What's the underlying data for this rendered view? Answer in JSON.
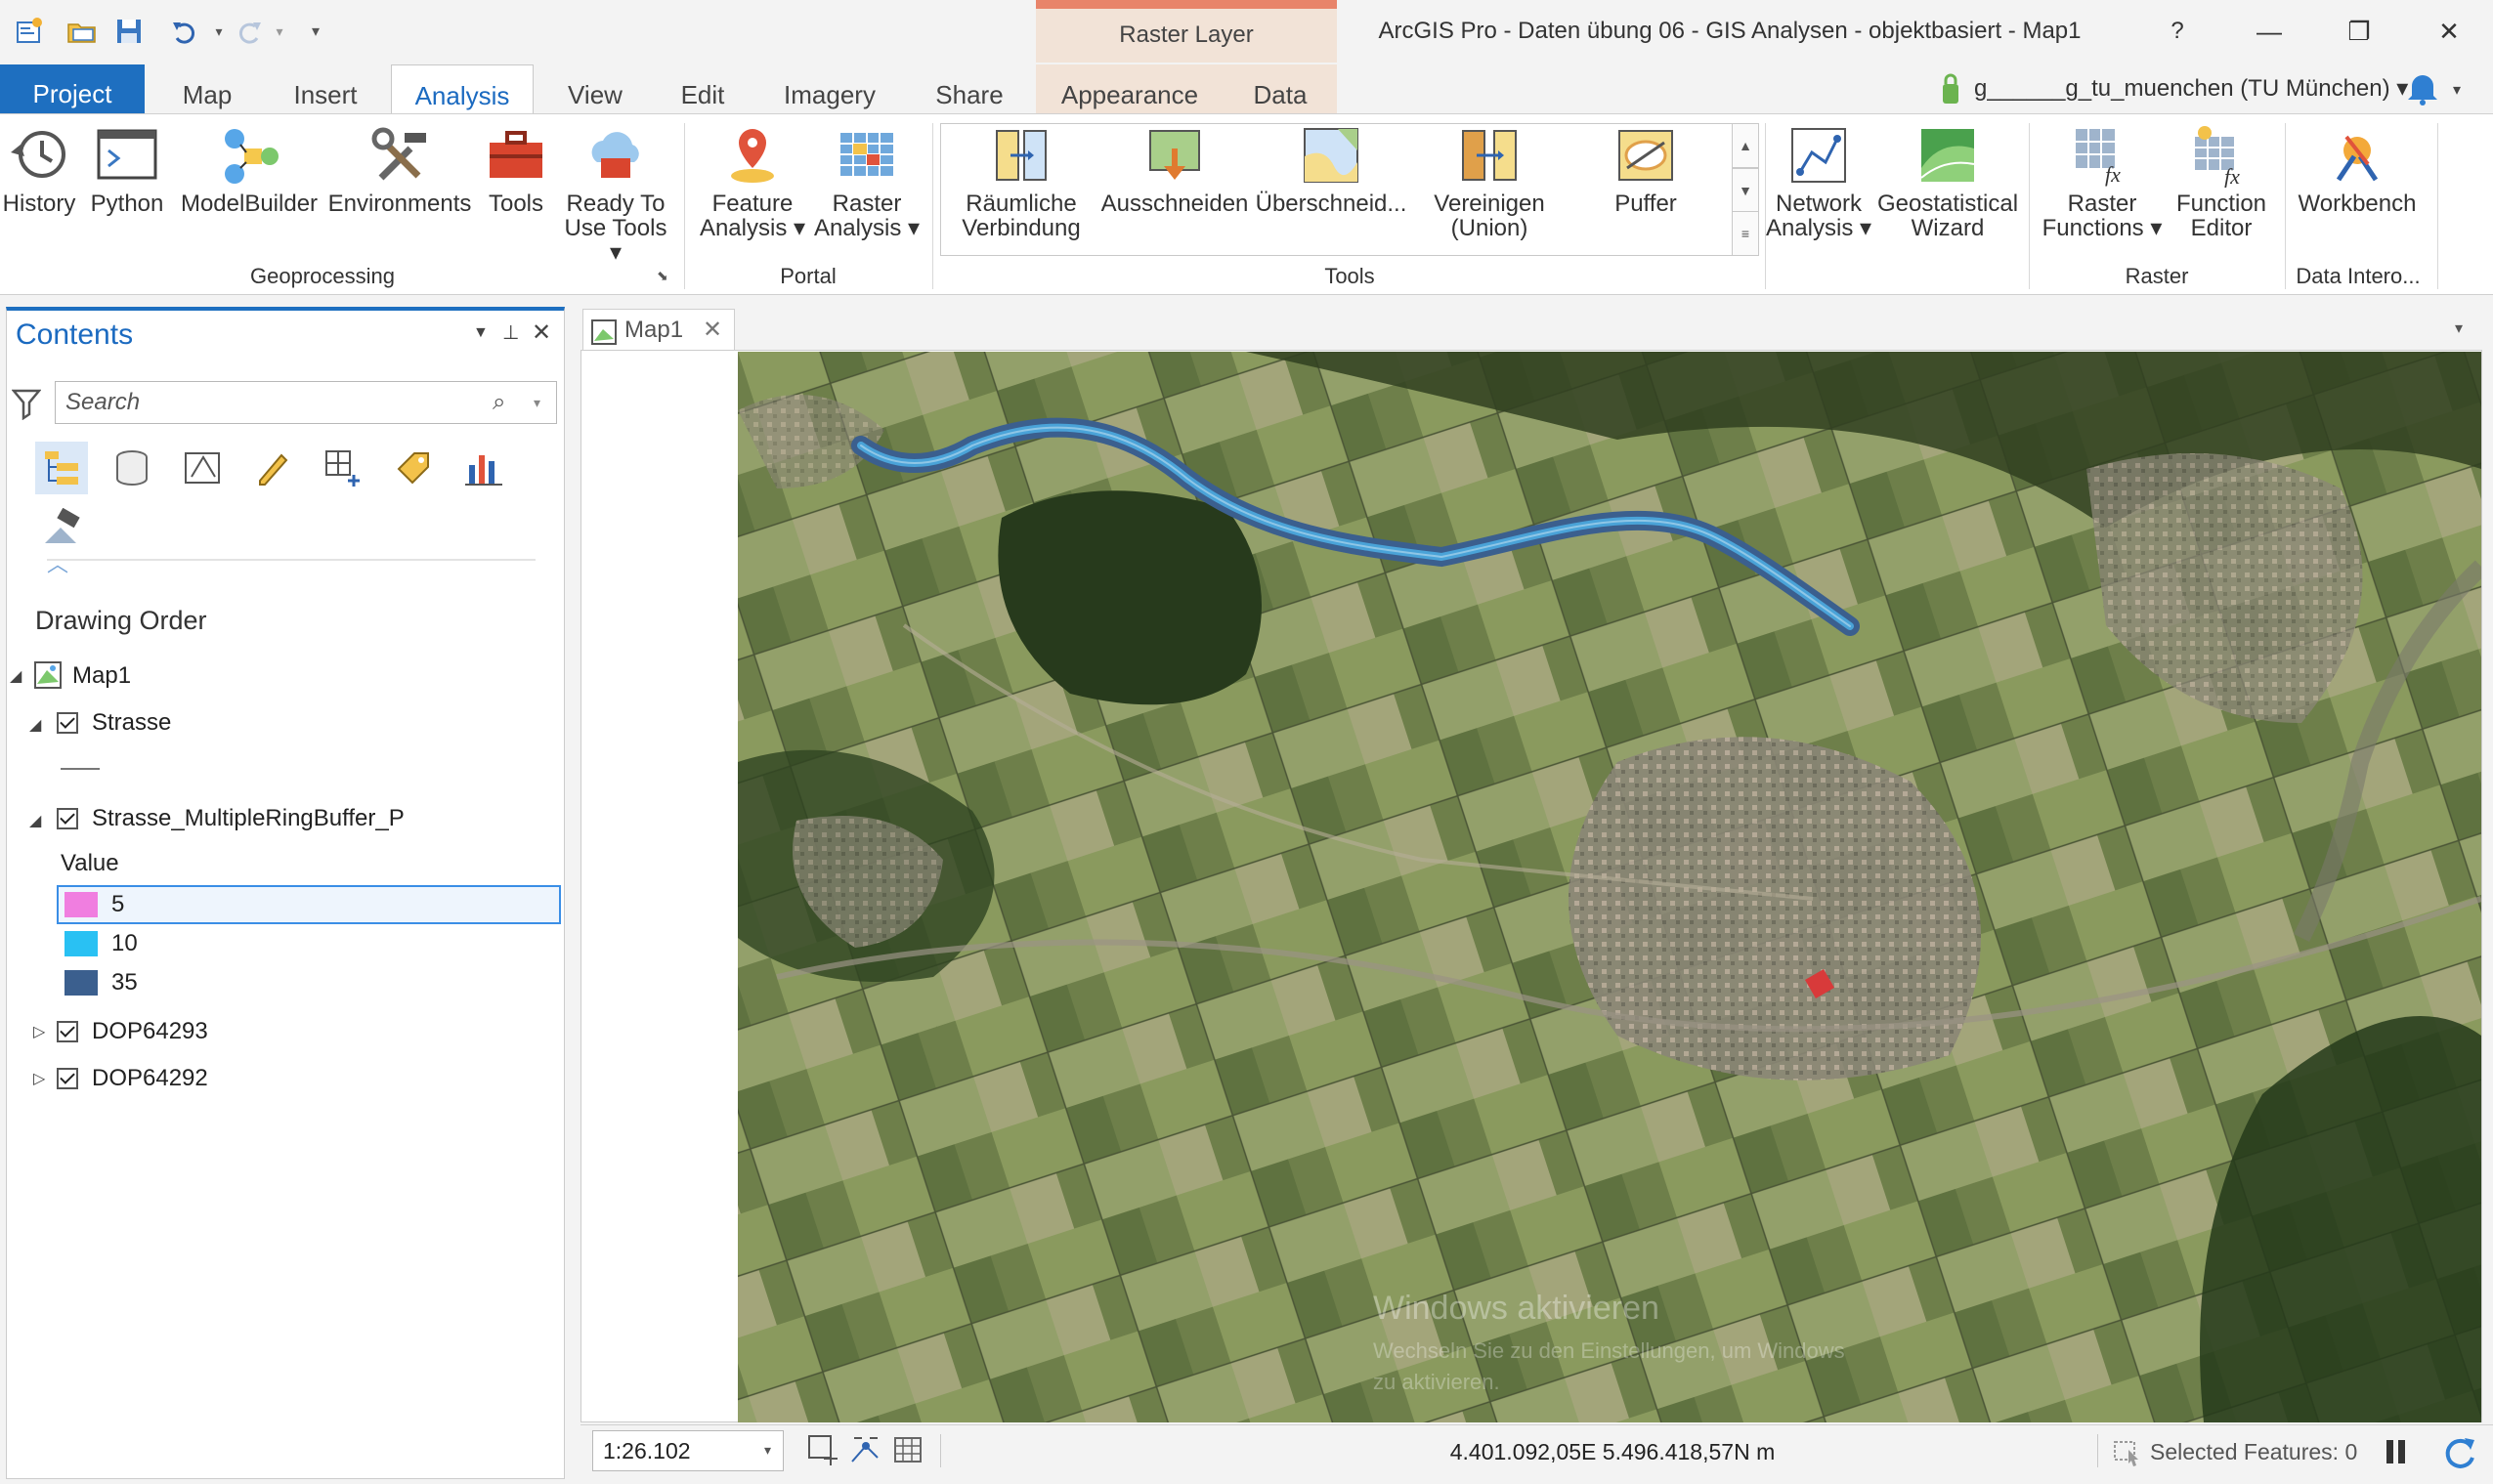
{
  "window": {
    "title": "ArcGIS Pro - Daten übung 06 - GIS Analysen - objektbasiert - Map1",
    "help": "?",
    "minimize": "—",
    "maximize": "❐",
    "close": "✕"
  },
  "context_tab": {
    "header": "Raster Layer"
  },
  "tabs": [
    "Project",
    "Map",
    "Insert",
    "Analysis",
    "View",
    "Edit",
    "Imagery",
    "Share",
    "Appearance",
    "Data"
  ],
  "active_tab": "Analysis",
  "user": {
    "label": "g______g_tu_muenchen (TU München) ▾"
  },
  "ribbon": {
    "geoprocessing": {
      "label": "Geoprocessing",
      "history": "History",
      "python": "Python",
      "modelbuilder": "ModelBuilder",
      "environments": "Environments",
      "tools": "Tools",
      "ready_to_use_1": "Ready To",
      "ready_to_use_2": "Use Tools ▾"
    },
    "portal": {
      "label": "Portal",
      "feature_1": "Feature",
      "feature_2": "Analysis ▾",
      "raster_1": "Raster",
      "raster_2": "Analysis ▾"
    },
    "tools": {
      "label": "Tools",
      "spatial_join_1": "Räumliche",
      "spatial_join_2": "Verbindung",
      "clip": "Ausschneiden",
      "intersect": "Überschneid...",
      "union_1": "Vereinigen",
      "union_2": "(Union)",
      "buffer": "Puffer"
    },
    "network_1": "Network",
    "network_2": "Analysis ▾",
    "geostat_1": "Geostatistical",
    "geostat_2": "Wizard",
    "raster": {
      "label": "Raster",
      "functions_1": "Raster",
      "functions_2": "Functions ▾",
      "editor_1": "Function",
      "editor_2": "Editor"
    },
    "interop": {
      "label": "Data Intero...",
      "workbench": "Workbench"
    }
  },
  "contents": {
    "title": "Contents",
    "search_placeholder": "Search",
    "drawing_order": "Drawing Order",
    "map": "Map1",
    "layer_strasse": "Strasse",
    "layer_buffer": "Strasse_MultipleRingBuffer_P",
    "value_header": "Value",
    "legend": [
      {
        "label": "5",
        "color": "#f07ee0"
      },
      {
        "label": "10",
        "color": "#29c1f3"
      },
      {
        "label": "35",
        "color": "#3b5f8e"
      }
    ],
    "layer_dop1": "DOP64293",
    "layer_dop2": "DOP64292"
  },
  "map_view": {
    "tab": "Map1",
    "scale": "1:26.102",
    "coordinates": "4.401.092,05E 5.496.418,57N m",
    "selected_features": "Selected Features: 0",
    "watermark_1": "Windows aktivieren",
    "watermark_2": "Wechseln Sie zu den Einstellungen, um Windows",
    "watermark_3": "zu aktivieren."
  },
  "colors": {
    "accent": "#1e6fc0",
    "context": "#e8846a",
    "road_outer": "#3b5f8e",
    "road_inner": "#4aa3d8"
  }
}
